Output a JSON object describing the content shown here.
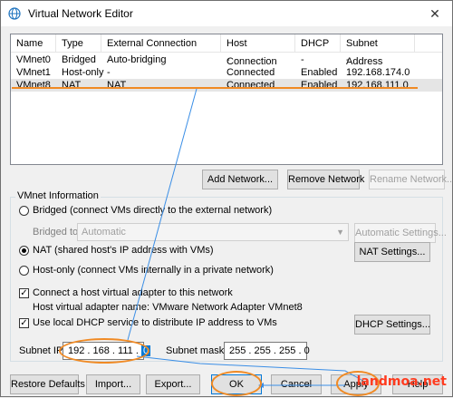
{
  "window": {
    "title": "Virtual Network Editor",
    "close_glyph": "✕"
  },
  "table": {
    "headers": [
      "Name",
      "Type",
      "External Connection",
      "Host Connection",
      "DHCP",
      "Subnet Address"
    ],
    "rows": [
      [
        "VMnet0",
        "Bridged",
        "Auto-bridging",
        "-",
        "-",
        "-"
      ],
      [
        "VMnet1",
        "Host-only",
        "-",
        "Connected",
        "Enabled",
        "192.168.174.0"
      ],
      [
        "VMnet8",
        "NAT",
        "NAT",
        "Connected",
        "Enabled",
        "192.168.111.0"
      ]
    ]
  },
  "list_buttons": {
    "add": "Add Network...",
    "remove": "Remove Network",
    "rename": "Rename Network..."
  },
  "vmnet_info": {
    "title": "VMnet Information",
    "bridged": "Bridged (connect VMs directly to the external network)",
    "bridged_to_label": "Bridged to:",
    "bridged_to_value": "Automatic",
    "automatic_settings": "Automatic Settings...",
    "nat": "NAT (shared host's IP address with VMs)",
    "nat_settings": "NAT Settings...",
    "host_only": "Host-only (connect VMs internally in a private network)",
    "connect_adapter": "Connect a host virtual adapter to this network",
    "adapter_name": "Host virtual adapter name: VMware Network Adapter VMnet8",
    "use_dhcp": "Use local DHCP service to distribute IP address to VMs",
    "dhcp_settings": "DHCP Settings...",
    "subnet_ip_label": "Subnet IP:",
    "subnet_ip_prefix": "192 . 168 . 111 .",
    "subnet_ip_last": "0",
    "subnet_mask_label": "Subnet mask:",
    "subnet_mask_value": "255 . 255 . 255 . 0"
  },
  "footer_buttons": {
    "restore": "Restore Defaults",
    "import": "Import...",
    "export": "Export...",
    "ok": "OK",
    "cancel": "Cancel",
    "apply": "Apply",
    "help": "Help"
  },
  "watermark": "landmoa.net",
  "annotation_color": "#f08a24",
  "arrow_color": "#3a8ee6"
}
